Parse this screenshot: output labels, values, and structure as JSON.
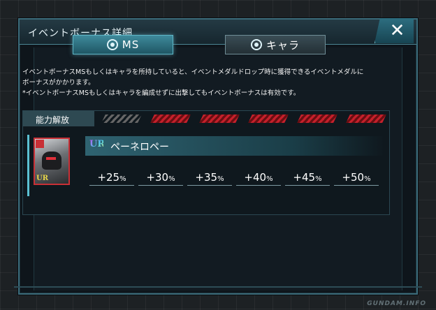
{
  "dialog": {
    "title": "イベントボーナス詳細",
    "close_label": "✕"
  },
  "tabs": [
    {
      "label": "MS",
      "active": true
    },
    {
      "label": "キャラ",
      "active": false
    }
  ],
  "description": {
    "line1": "イベントボーナスMSもしくはキャラを所持していると、イベントメダルドロップ時に獲得できるイベントメダルに",
    "line2": "ボーナスがかかります。",
    "line3": "*イベントボーナスMSもしくはキャラを編成せずに出撃してもイベントボーナスは有効です。"
  },
  "ability": {
    "label": "能力解放",
    "levels_total": 6,
    "levels_active": [
      false,
      true,
      true,
      true,
      true,
      true
    ]
  },
  "unit": {
    "rarity": "UR",
    "name": "ペーネロペー",
    "avatar_badge": "UR"
  },
  "bonuses": [
    "+25",
    "+30",
    "+35",
    "+40",
    "+45",
    "+50"
  ],
  "bonus_unit": "%",
  "watermark": "GUNDAM.INFO",
  "colors": {
    "accent": "#5bc0d2",
    "active_bar": "#c4202b",
    "frame": "#3b6b7a"
  }
}
